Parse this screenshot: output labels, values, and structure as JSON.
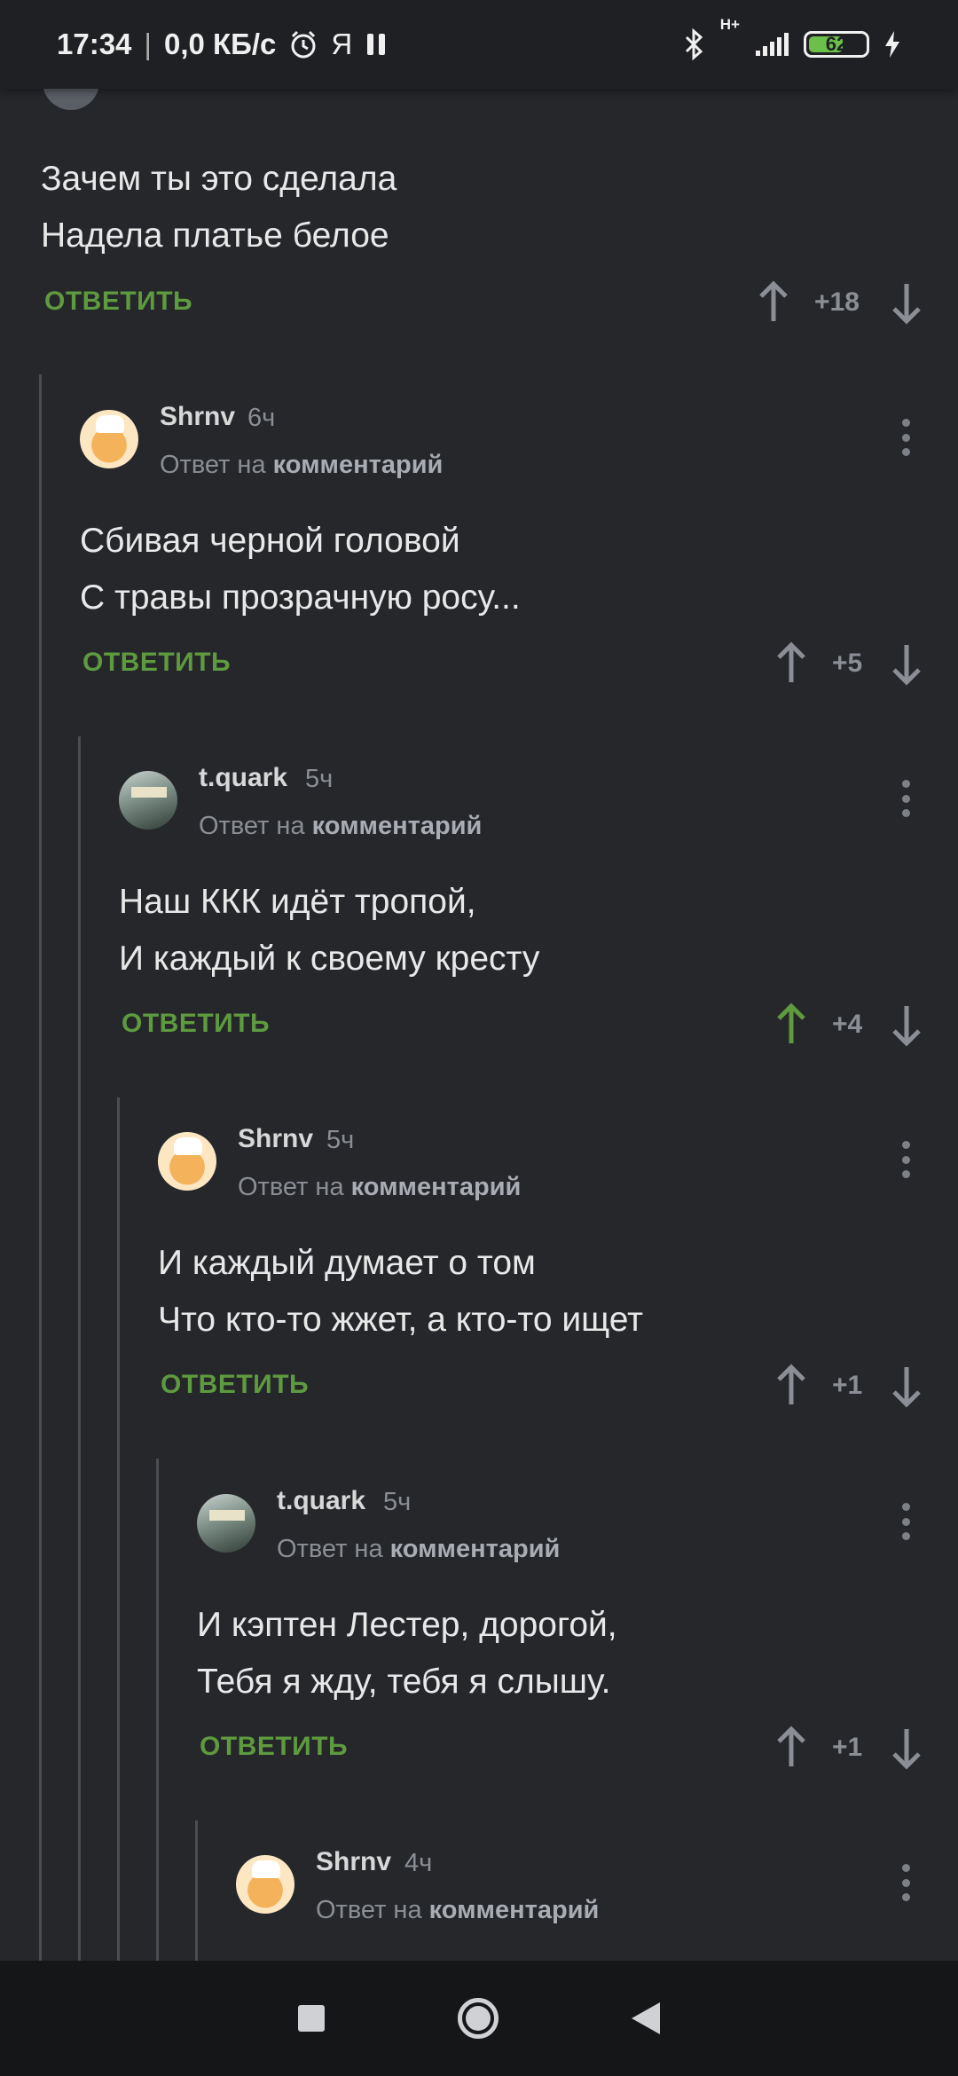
{
  "status_bar": {
    "time": "17:34",
    "speed": "0,0 КБ/с",
    "yandex_glyph": "Я",
    "network": "H+",
    "battery": "62",
    "battery_level": 0.62,
    "icons": [
      "alarm-clock-icon",
      "pause-icon",
      "bluetooth-icon",
      "signal-icon",
      "charging-icon"
    ]
  },
  "comments": [
    {
      "id": "c0",
      "lines": [
        "Зачем ты это сделала",
        "Надела платье белое"
      ],
      "reply_label": "ОТВЕТИТЬ",
      "score": "+18",
      "upvoted": false
    },
    {
      "id": "c1",
      "username": "Shrnv",
      "time": "6ч",
      "reply_to_prefix": "Ответ на",
      "reply_to_link": "комментарий",
      "lines": [
        "Сбивая черной головой",
        "С травы прозрачную росу..."
      ],
      "reply_label": "ОТВЕТИТЬ",
      "score": "+5",
      "upvoted": false
    },
    {
      "id": "c2",
      "username": "t.quark",
      "time": "5ч",
      "reply_to_prefix": "Ответ на",
      "reply_to_link": "комментарий",
      "lines": [
        "Наш ККК идёт тропой,",
        "И каждый к своему кресту"
      ],
      "reply_label": "ОТВЕТИТЬ",
      "score": "+4",
      "upvoted": true
    },
    {
      "id": "c3",
      "username": "Shrnv",
      "time": "5ч",
      "reply_to_prefix": "Ответ на",
      "reply_to_link": "комментарий",
      "lines": [
        "И каждый думает о том",
        "Что кто-то жжет, а кто-то ищет"
      ],
      "reply_label": "ОТВЕТИТЬ",
      "score": "+1",
      "upvoted": false
    },
    {
      "id": "c4",
      "username": "t.quark",
      "time": "5ч",
      "reply_to_prefix": "Ответ на",
      "reply_to_link": "комментарий",
      "lines": [
        "И кэптен Лестер, дорогой,",
        "Тебя я жду, тебя я слышу."
      ],
      "reply_label": "ОТВЕТИТЬ",
      "score": "+1",
      "upvoted": false
    },
    {
      "id": "c5",
      "username": "Shrnv",
      "time": "4ч",
      "reply_to_prefix": "Ответ на",
      "reply_to_link": "комментарий"
    }
  ],
  "colors": {
    "background": "#25272b",
    "accent_green": "#5e9a3e",
    "muted": "#8b8f95"
  }
}
